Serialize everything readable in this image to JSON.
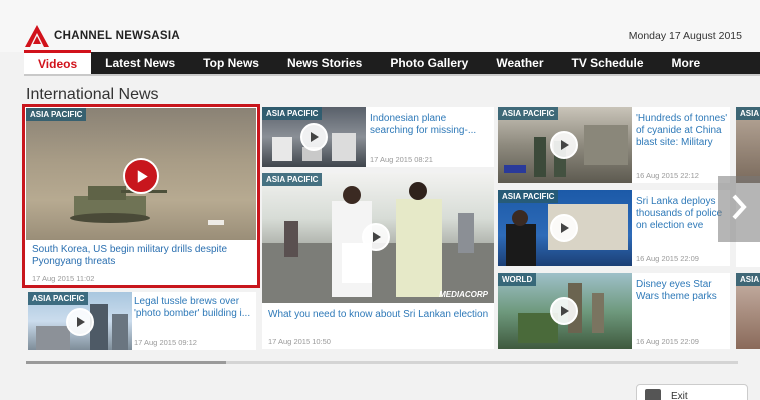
{
  "brand": {
    "name": "CHANNEL NEWSASIA",
    "accent": "#d1121b"
  },
  "header": {
    "date": "Monday 17 August 2015"
  },
  "nav": {
    "items": [
      {
        "label": "Videos"
      },
      {
        "label": "Latest News"
      },
      {
        "label": "Top News"
      },
      {
        "label": "News Stories"
      },
      {
        "label": "Photo Gallery"
      },
      {
        "label": "Weather"
      },
      {
        "label": "TV Schedule"
      },
      {
        "label": "More"
      }
    ],
    "active": "Videos"
  },
  "section": {
    "title": "International News"
  },
  "cards": [
    {
      "badge": "ASIA PACIFIC",
      "title": "South Korea, US begin military drills despite Pyongyang threats",
      "time": "17 Aug 2015  11:02",
      "selected": true
    },
    {
      "badge": "ASIA PACIFIC",
      "title": "Legal tussle brews over 'photo bomber' building i...",
      "time": "17 Aug 2015  09:12"
    },
    {
      "badge": "ASIA PACIFIC",
      "title": "Indonesian plane searching for missing-...",
      "time": "17 Aug 2015  08:21"
    },
    {
      "badge": "ASIA PACIFIC",
      "title": "What you need to know about Sri Lankan election",
      "time": "17 Aug 2015  10:50",
      "watermark": "MEDIACORP"
    },
    {
      "badge": "ASIA PACIFIC",
      "title": "'Hundreds of tonnes' of cyanide at China blast site: Military",
      "time": "16 Aug 2015  22:12"
    },
    {
      "badge": "ASIA PACIFIC",
      "title": "Sri Lanka deploys thousands of police on election eve",
      "time": "16 Aug 2015  22:09"
    },
    {
      "badge": "WORLD",
      "title": "Disney eyes Star Wars theme parks",
      "time": "16 Aug 2015  22:09"
    },
    {
      "badge": "ASIA",
      "title": "",
      "time": ""
    },
    {
      "badge": "ASIA",
      "title": "",
      "time": ""
    }
  ],
  "icons": {
    "play": "play-icon",
    "next": "chevron-right-icon",
    "exit": "exit-icon"
  },
  "footer": {
    "exit_label": "Exit"
  },
  "scroll": {
    "position": 0.28
  }
}
